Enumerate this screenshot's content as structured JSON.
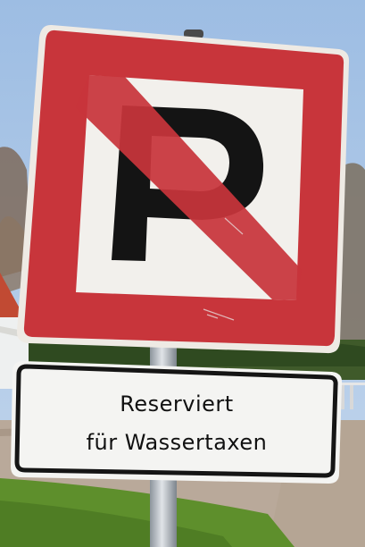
{
  "scene": {
    "main_sign": {
      "icon": "no-parking-p-sign",
      "letter": "P",
      "colors": {
        "red": "#c8353b",
        "white": "#f2f0ec",
        "black": "#141414"
      }
    },
    "plate": {
      "line1": "Reserviert",
      "line2": "für Wassertaxen"
    },
    "colors": {
      "sky": "#a9c6e6",
      "grass": "#5e8f2c",
      "pavement": "#b9a99a"
    }
  }
}
